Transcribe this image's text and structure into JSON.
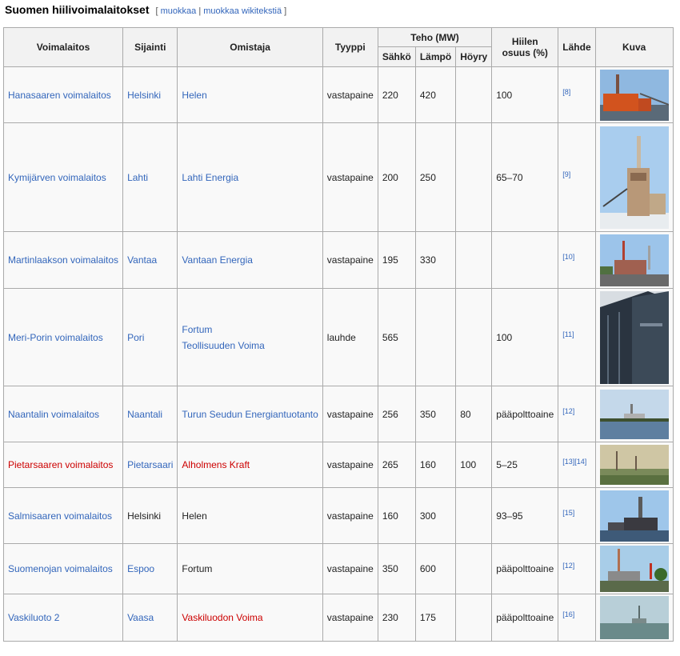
{
  "heading": {
    "title": "Suomen hiilivoimalaitokset",
    "edit_open": "[",
    "edit_link": "muokkaa",
    "edit_sep": "|",
    "edit_source_link": "muokkaa wikitekstiä",
    "edit_close": "]"
  },
  "table": {
    "headers": {
      "plant": "Voimalaitos",
      "location": "Sijainti",
      "owner": "Omistaja",
      "type": "Tyyppi",
      "capacity": "Teho (MW)",
      "electric": "Sähkö",
      "heat": "Lämpö",
      "steam": "Höyry",
      "coal_share_line1": "Hiilen",
      "coal_share_line2": "osuus (%)",
      "source": "Lähde",
      "image": "Kuva"
    },
    "rows": [
      {
        "plant": "Hanasaaren voimalaitos",
        "location": "Helsinki",
        "owner": "Helen",
        "owner2": "",
        "type": "vastapaine",
        "electric": "220",
        "heat": "420",
        "steam": "",
        "coal": "100",
        "source": "[8]"
      },
      {
        "plant": "Kymijärven voimalaitos",
        "location": "Lahti",
        "owner": "Lahti Energia",
        "owner2": "",
        "type": "vastapaine",
        "electric": "200",
        "heat": "250",
        "steam": "",
        "coal": "65–70",
        "source": "[9]"
      },
      {
        "plant": "Martinlaakson voimalaitos",
        "location": "Vantaa",
        "owner": "Vantaan Energia",
        "owner2": "",
        "type": "vastapaine",
        "electric": "195",
        "heat": "330",
        "steam": "",
        "coal": "",
        "source": "[10]"
      },
      {
        "plant": "Meri-Porin voimalaitos",
        "location": "Pori",
        "owner": "Fortum",
        "owner2": "Teollisuuden Voima",
        "type": "lauhde",
        "electric": "565",
        "heat": "",
        "steam": "",
        "coal": "100",
        "source": "[11]"
      },
      {
        "plant": "Naantalin voimalaitos",
        "location": "Naantali",
        "owner": "Turun Seudun Energiantuotanto",
        "owner2": "",
        "type": "vastapaine",
        "electric": "256",
        "heat": "350",
        "steam": "80",
        "coal": "pääpolttoaine",
        "source": "[12]"
      },
      {
        "plant": "Pietarsaaren voimalaitos",
        "location": "Pietarsaari",
        "owner": "Alholmens Kraft",
        "owner2": "",
        "type": "vastapaine",
        "electric": "265",
        "heat": "160",
        "steam": "100",
        "coal": "5–25",
        "source": "[13][14]"
      },
      {
        "plant": "Salmisaaren voimalaitos",
        "location": "Helsinki",
        "owner": "Helen",
        "owner2": "",
        "type": "vastapaine",
        "electric": "160",
        "heat": "300",
        "steam": "",
        "coal": "93–95",
        "source": "[15]"
      },
      {
        "plant": "Suomenojan voimalaitos",
        "location": "Espoo",
        "owner": "Fortum",
        "owner2": "",
        "type": "vastapaine",
        "electric": "350",
        "heat": "600",
        "steam": "",
        "coal": "pääpolttoaine",
        "source": "[12]"
      },
      {
        "plant": "Vaskiluoto 2",
        "location": "Vaasa",
        "owner": "Vaskiluodon Voima",
        "owner2": "",
        "type": "vastapaine",
        "electric": "230",
        "heat": "175",
        "steam": "",
        "coal": "pääpolttoaine",
        "source": "[16]"
      }
    ]
  },
  "colors": {
    "link": "#3366bb",
    "redlink": "#cc0000",
    "border": "#aaaaaa",
    "header_bg": "#f2f2f2",
    "cell_bg": "#f9f9f9"
  }
}
